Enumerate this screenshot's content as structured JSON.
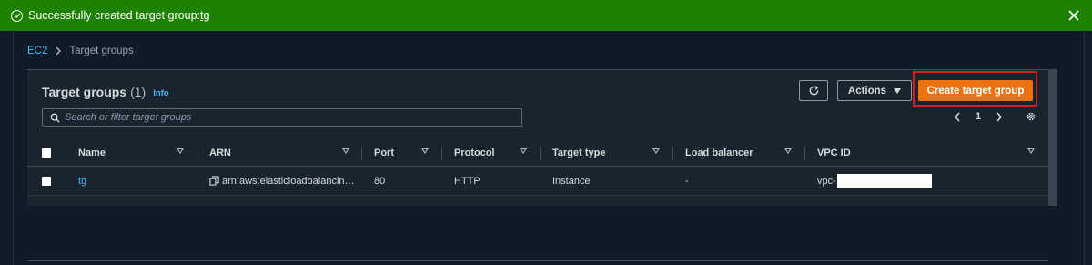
{
  "flash": {
    "message_prefix": "Successfully created target group: ",
    "target_group_name": "tg",
    "color": "#1d8102"
  },
  "breadcrumb": {
    "root": "EC2",
    "current": "Target groups"
  },
  "panel": {
    "title": "Target groups",
    "count": "(1)",
    "info_link": "Info",
    "actions_label": "Actions",
    "create_label": "Create target group",
    "create_color": "#ec7211",
    "search_placeholder": "Search or filter target groups",
    "page_number": "1"
  },
  "table": {
    "columns": [
      "Name",
      "ARN",
      "Port",
      "Protocol",
      "Target type",
      "Load balancer",
      "VPC ID"
    ],
    "rows": [
      {
        "name": "tg",
        "arn": "arn:aws:elasticloadbalancin…",
        "port": "80",
        "protocol": "HTTP",
        "target_type": "Instance",
        "load_balancer": "-",
        "vpc_prefix": "vpc-"
      }
    ]
  },
  "icons": {
    "flash_status": "check-circle-icon",
    "flash_close": "close-icon",
    "breadcrumb_separator": "chevron-right-icon",
    "refresh": "refresh-icon",
    "actions_caret": "caret-down-icon",
    "search": "search-icon",
    "prev_page": "chevron-left-icon",
    "next_page": "chevron-right-icon",
    "settings": "gear-icon",
    "copy": "copy-icon"
  }
}
